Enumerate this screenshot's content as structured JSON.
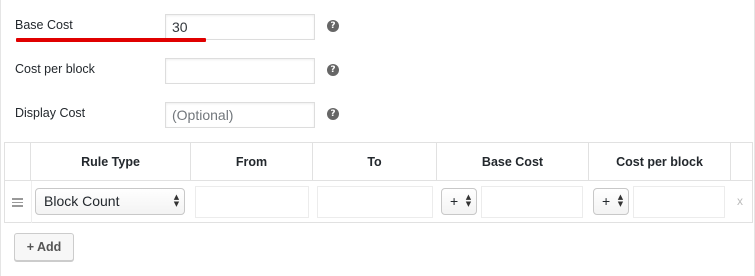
{
  "fields": {
    "base_cost": {
      "label": "Base Cost",
      "value": "30",
      "help_icon": "question-circle-icon"
    },
    "cost_per_block": {
      "label": "Cost per block",
      "value": "",
      "help_icon": "question-circle-icon"
    },
    "display_cost": {
      "label": "Display Cost",
      "placeholder": "(Optional)",
      "help_icon": "question-circle-icon"
    }
  },
  "highlight_color": "#e00000",
  "table": {
    "headers": [
      "Rule Type",
      "From",
      "To",
      "Base Cost",
      "Cost per block"
    ],
    "row": {
      "rule_type": "Block Count",
      "base_cost_modifier": "+",
      "cost_per_block_modifier": "+",
      "remove_label": "x"
    }
  },
  "add_button_label": "+ Add",
  "help_glyph": "?"
}
